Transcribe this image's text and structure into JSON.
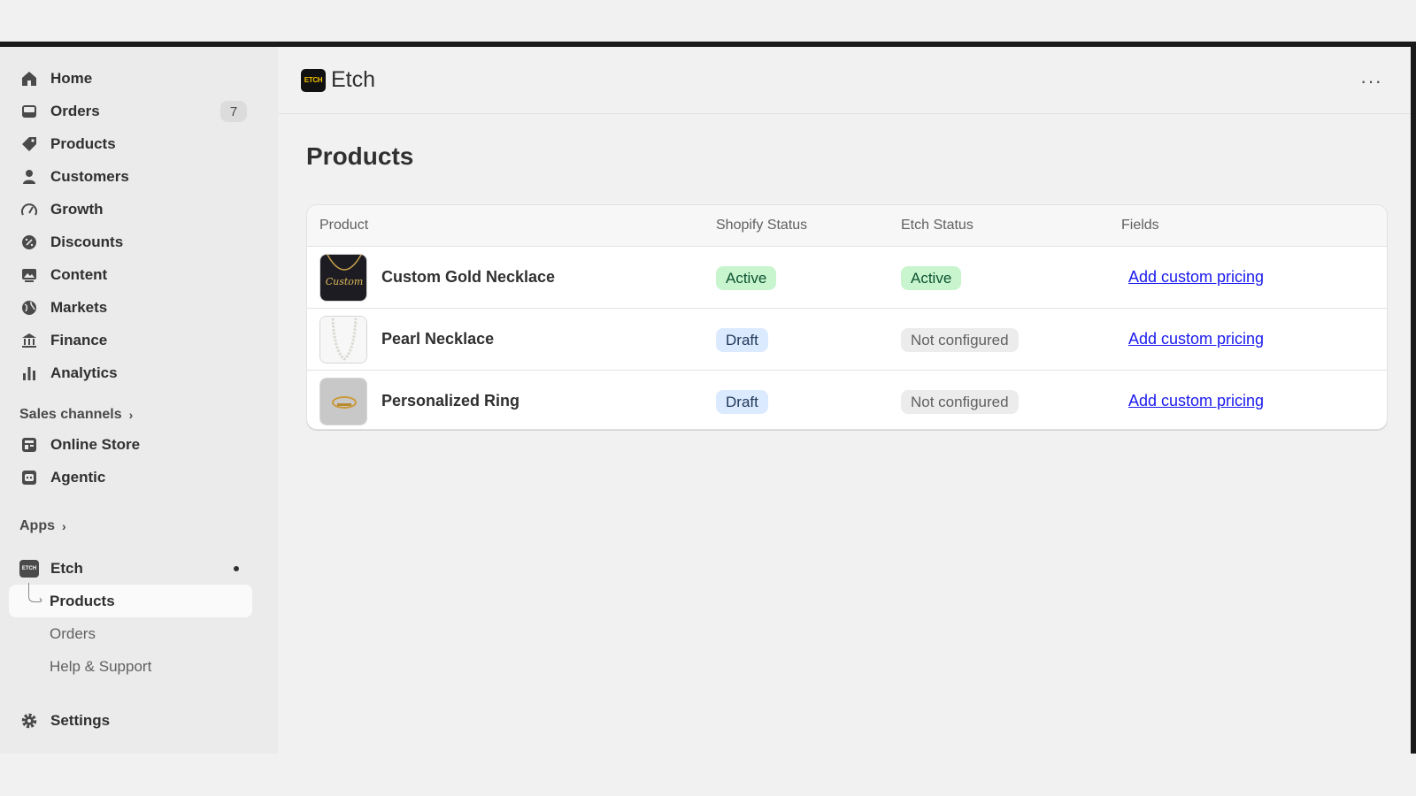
{
  "sidebar": {
    "items": [
      {
        "label": "Home",
        "icon": "home-icon"
      },
      {
        "label": "Orders",
        "icon": "inbox-icon",
        "badge": "7"
      },
      {
        "label": "Products",
        "icon": "tag-icon"
      },
      {
        "label": "Customers",
        "icon": "person-icon"
      },
      {
        "label": "Growth",
        "icon": "gauge-icon"
      },
      {
        "label": "Discounts",
        "icon": "discount-icon"
      },
      {
        "label": "Content",
        "icon": "image-icon"
      },
      {
        "label": "Markets",
        "icon": "globe-icon"
      },
      {
        "label": "Finance",
        "icon": "bank-icon"
      },
      {
        "label": "Analytics",
        "icon": "bar-chart-icon"
      }
    ],
    "sales_channels_label": "Sales channels",
    "channels": [
      {
        "label": "Online Store",
        "icon": "store-icon"
      },
      {
        "label": "Agentic",
        "icon": "robot-icon"
      }
    ],
    "apps_label": "Apps",
    "app": {
      "label": "Etch",
      "logo_text": "ETCH",
      "sub_items": [
        "Products",
        "Orders",
        "Help & Support"
      ]
    },
    "settings_label": "Settings"
  },
  "header": {
    "logo_text": "ETCH",
    "title": "Etch",
    "more": "···"
  },
  "page": {
    "title": "Products",
    "table": {
      "columns": [
        "Product",
        "Shopify Status",
        "Etch Status",
        "Fields"
      ],
      "rows": [
        {
          "name": "Custom Gold Necklace",
          "shopify_status": "Active",
          "etch_status": "Active",
          "field_link": "Add custom pricing"
        },
        {
          "name": "Pearl Necklace",
          "shopify_status": "Draft",
          "etch_status": "Not configured",
          "field_link": "Add custom pricing"
        },
        {
          "name": "Personalized Ring",
          "shopify_status": "Draft",
          "etch_status": "Not configured",
          "field_link": "Add custom pricing"
        }
      ]
    }
  },
  "colors": {
    "active_pill": "#c8f5cd",
    "draft_pill": "#dbeafe",
    "neutral_pill": "#ececec",
    "link": "#1a1aee"
  }
}
